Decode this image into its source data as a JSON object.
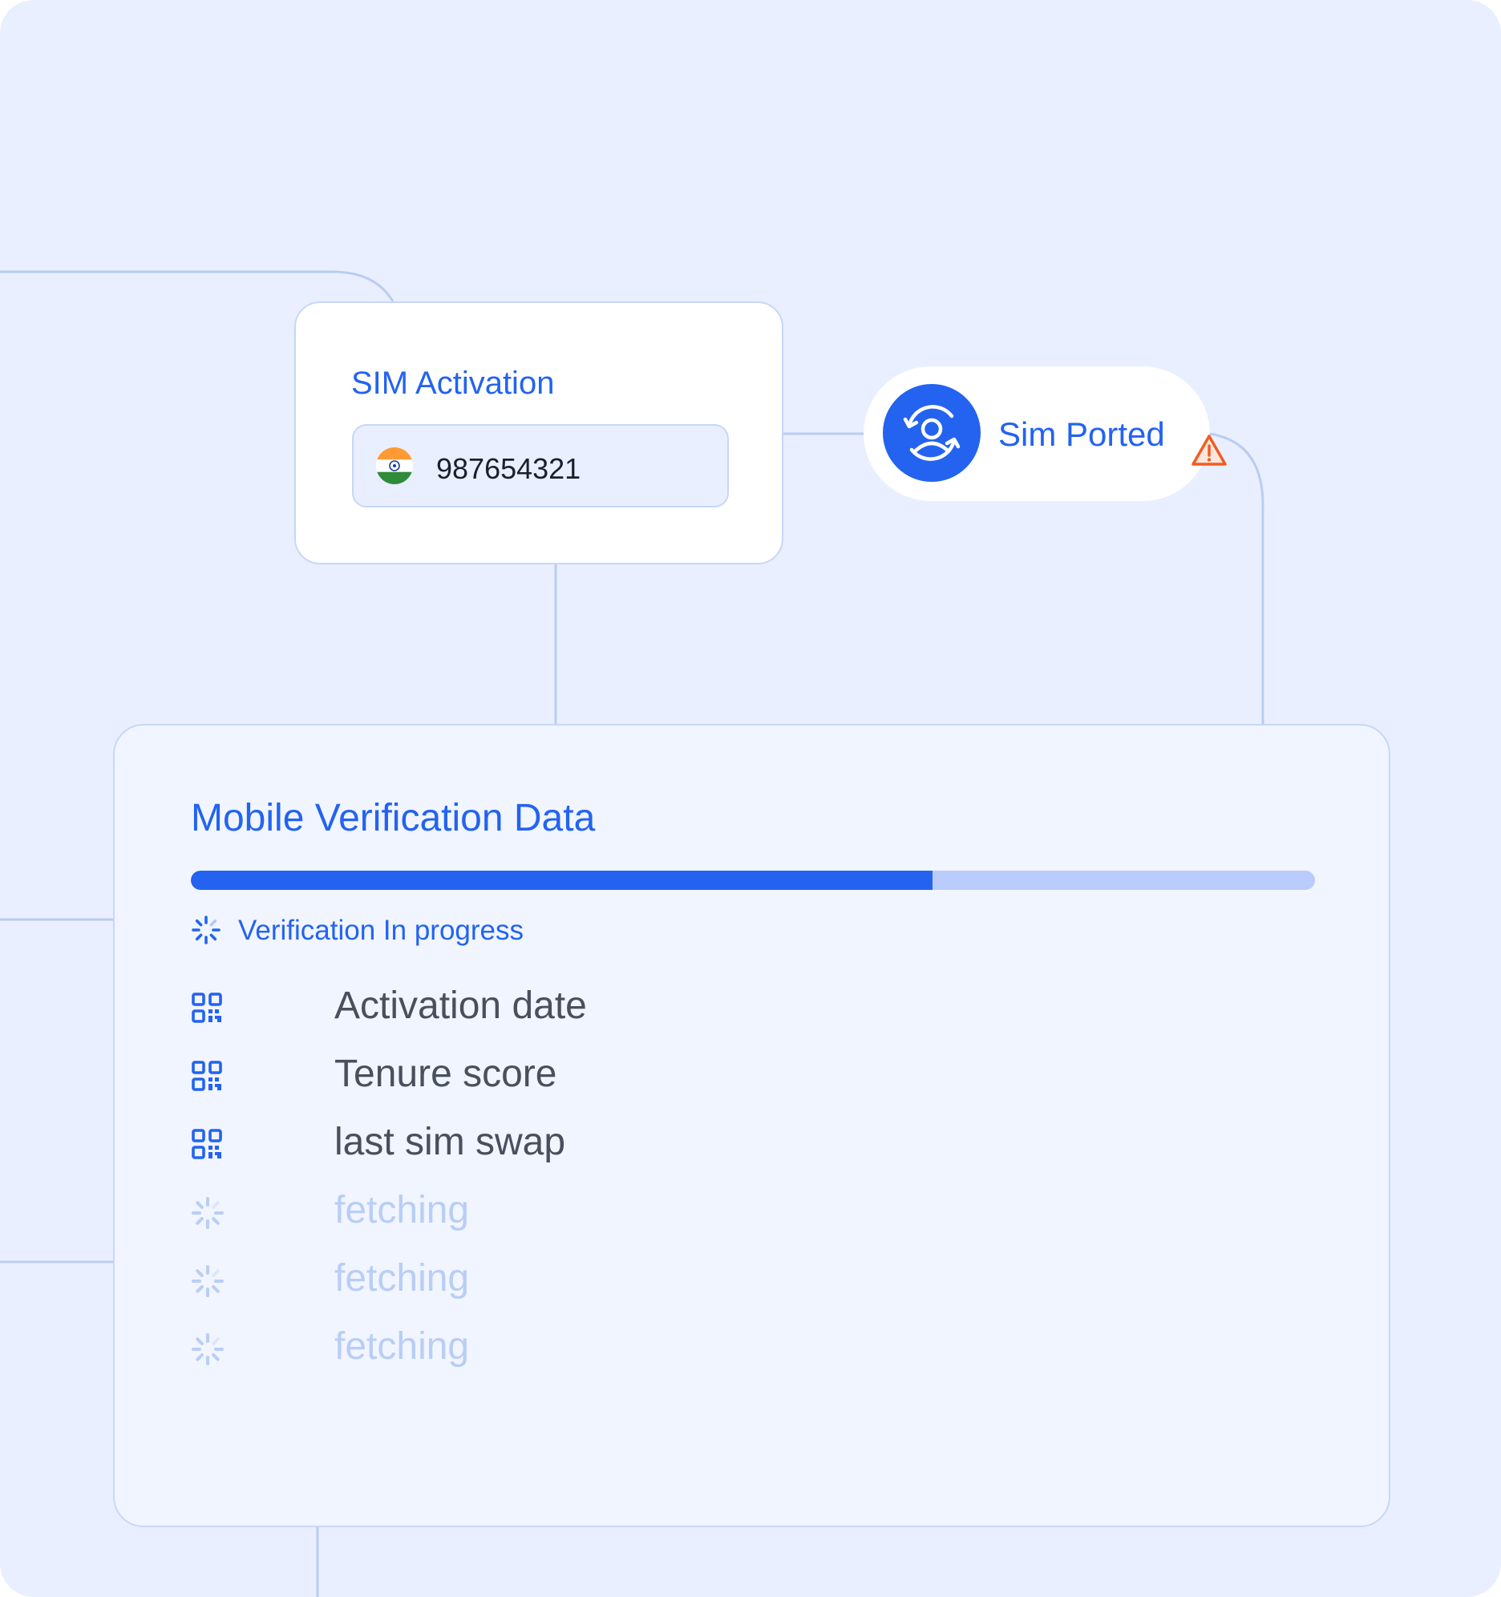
{
  "sim_activation": {
    "title": "SIM Activation",
    "phone_number": "987654321",
    "flag_icon": "india-flag-icon"
  },
  "sim_ported": {
    "label": "Sim Ported",
    "icon": "user-swap-icon",
    "alert_icon": "warning-triangle-icon"
  },
  "verification": {
    "title": "Mobile Verification Data",
    "progress_fraction": 0.66,
    "status_text": "Verification In progress",
    "items": [
      {
        "label": "Activation date",
        "state": "done",
        "icon": "qr-code-icon"
      },
      {
        "label": "Tenure score",
        "state": "done",
        "icon": "qr-code-icon"
      },
      {
        "label": "last sim swap",
        "state": "done",
        "icon": "qr-code-icon"
      },
      {
        "label": "fetching",
        "state": "pending",
        "icon": "loading-spinner-icon"
      },
      {
        "label": "fetching",
        "state": "pending",
        "icon": "loading-spinner-icon"
      },
      {
        "label": "fetching",
        "state": "pending",
        "icon": "loading-spinner-icon"
      }
    ]
  },
  "colors": {
    "background": "#e9efff",
    "accent": "#2363f0",
    "progress_track": "#b9ccfb",
    "connector": "#b9cdf3",
    "warning": "#f25c22",
    "muted_text": "#b9cdf6",
    "body_text": "#4a4f5e"
  }
}
